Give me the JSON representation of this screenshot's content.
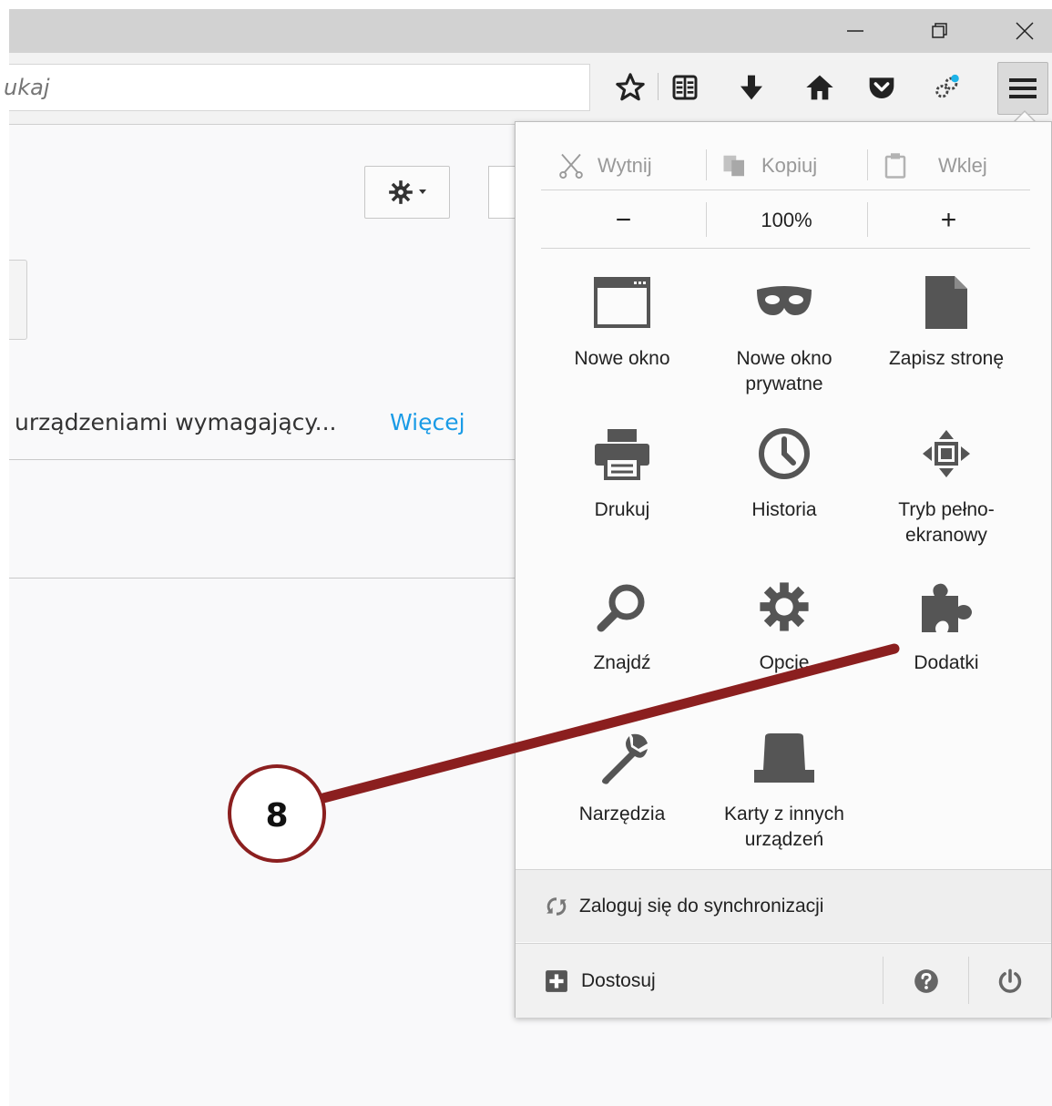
{
  "window": {
    "controls": [
      "minimize-icon",
      "restore-icon",
      "close-icon"
    ]
  },
  "toolbar": {
    "url_placeholder": "ukaj",
    "icons": [
      "star-icon",
      "reading-list-icon",
      "download-icon",
      "home-icon",
      "pocket-icon",
      "extension-icon",
      "hamburger-menu-icon"
    ]
  },
  "page": {
    "notice_text": "urządzeniami wymagający...",
    "more_link": "Więcej"
  },
  "menu": {
    "edit": {
      "cut": "Wytnij",
      "copy": "Kopiuj",
      "paste": "Wklej"
    },
    "zoom": {
      "minus": "−",
      "level": "100%",
      "plus": "+"
    },
    "items": [
      {
        "label": "Nowe okno",
        "icon": "new-window-icon"
      },
      {
        "label": "Nowe okno\nprywatne",
        "icon": "private-mask-icon"
      },
      {
        "label": "Zapisz stronę",
        "icon": "save-page-icon"
      },
      {
        "label": "Drukuj",
        "icon": "printer-icon"
      },
      {
        "label": "Historia",
        "icon": "clock-icon"
      },
      {
        "label": "Tryb pełno-\nekranowy",
        "icon": "fullscreen-icon"
      },
      {
        "label": "Znajdź",
        "icon": "magnifier-icon"
      },
      {
        "label": "Opcje",
        "icon": "gear-icon"
      },
      {
        "label": "Dodatki",
        "icon": "puzzle-icon"
      },
      {
        "label": "Narzędzia",
        "icon": "wrench-icon"
      },
      {
        "label": "Karty z innych\nurządzeń",
        "icon": "synced-tabs-icon"
      }
    ],
    "sync_label": "Zaloguj się do synchronizacji",
    "customize_label": "Dostosuj"
  },
  "annotation": {
    "number": "8",
    "color": "#8b1f1f"
  }
}
